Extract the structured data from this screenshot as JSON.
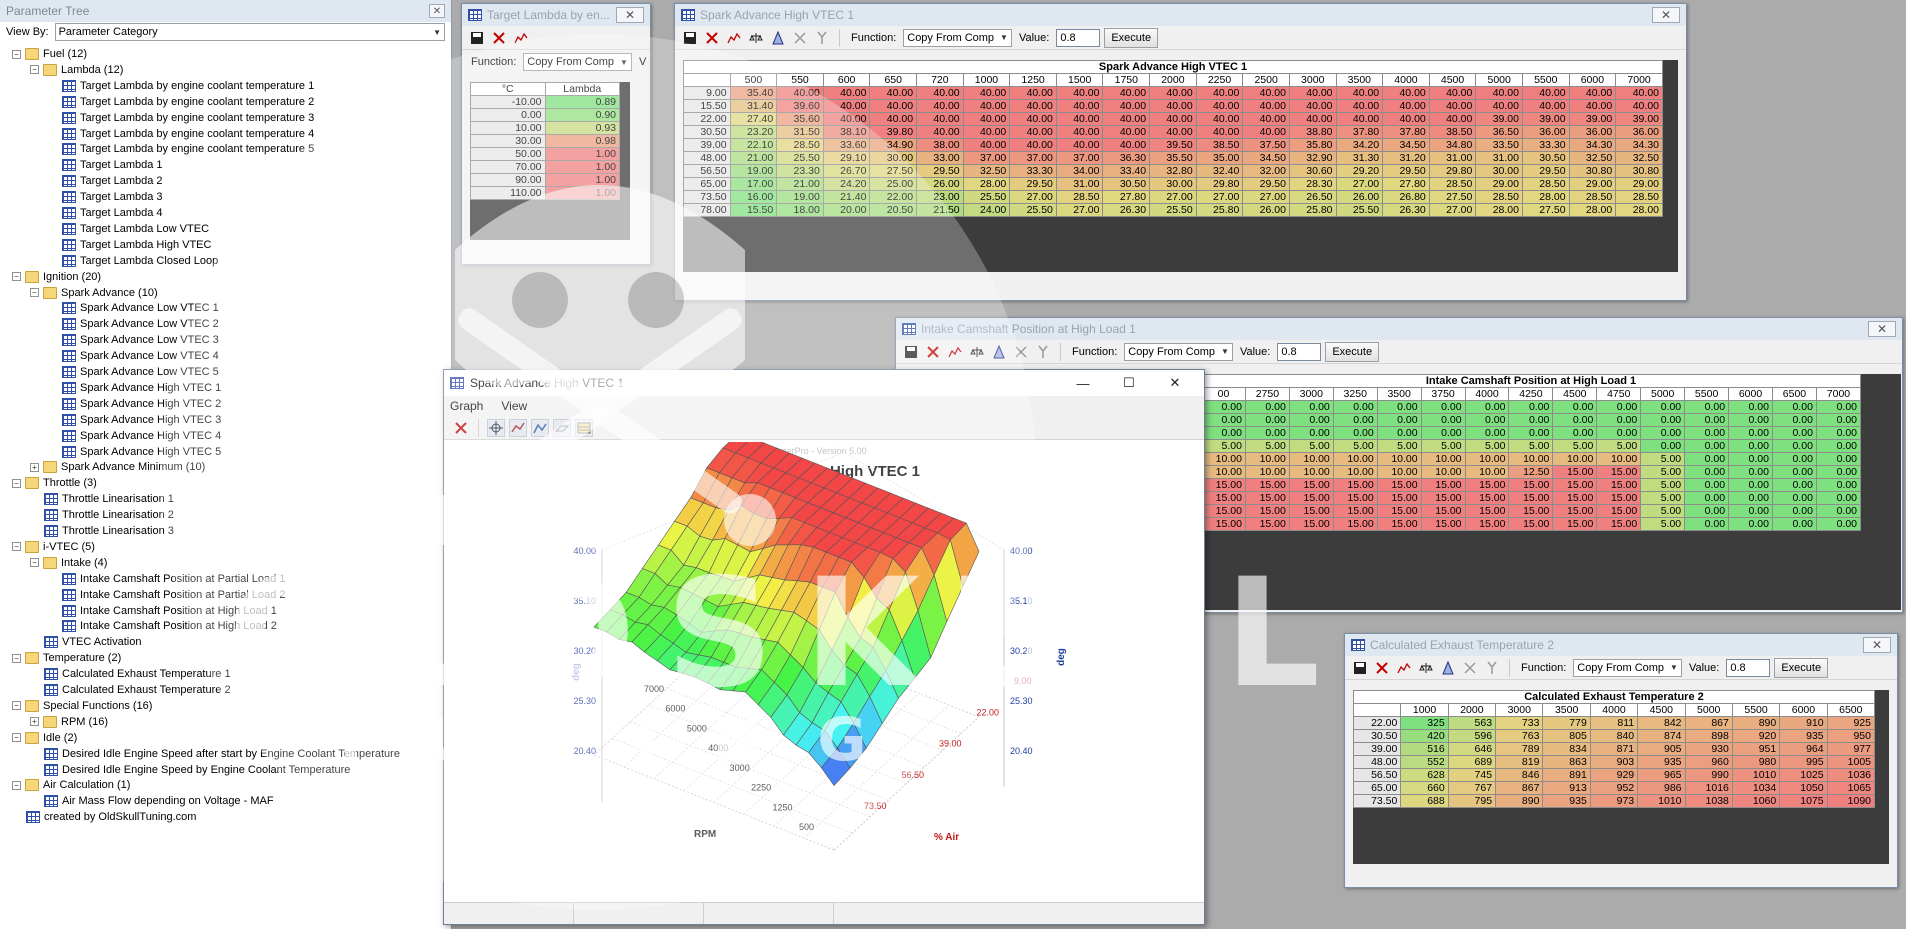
{
  "tree": {
    "title": "Parameter Tree",
    "view_by_label": "View By:",
    "view_by_value": "Parameter Category",
    "close_icon": "close-icon",
    "nodes": [
      {
        "label": "Fuel (12)",
        "depth": 0,
        "kind": "folder",
        "exp": "−"
      },
      {
        "label": "Lambda (12)",
        "depth": 1,
        "kind": "folder",
        "exp": "−"
      },
      {
        "label": "Target Lambda by engine coolant temperature 1",
        "depth": 2,
        "kind": "table"
      },
      {
        "label": "Target Lambda by engine coolant temperature 2",
        "depth": 2,
        "kind": "table"
      },
      {
        "label": "Target Lambda by engine coolant temperature 3",
        "depth": 2,
        "kind": "table"
      },
      {
        "label": "Target Lambda by engine coolant temperature 4",
        "depth": 2,
        "kind": "table"
      },
      {
        "label": "Target Lambda by engine coolant temperature 5",
        "depth": 2,
        "kind": "table"
      },
      {
        "label": "Target Lambda 1",
        "depth": 2,
        "kind": "table"
      },
      {
        "label": "Target Lambda 2",
        "depth": 2,
        "kind": "table"
      },
      {
        "label": "Target Lambda 3",
        "depth": 2,
        "kind": "table"
      },
      {
        "label": "Target Lambda 4",
        "depth": 2,
        "kind": "table"
      },
      {
        "label": "Target Lambda Low VTEC",
        "depth": 2,
        "kind": "table"
      },
      {
        "label": "Target Lambda High VTEC",
        "depth": 2,
        "kind": "table"
      },
      {
        "label": "Target Lambda Closed Loop",
        "depth": 2,
        "kind": "table"
      },
      {
        "label": "Ignition (20)",
        "depth": 0,
        "kind": "folder",
        "exp": "−"
      },
      {
        "label": "Spark Advance (10)",
        "depth": 1,
        "kind": "folder",
        "exp": "−"
      },
      {
        "label": "Spark Advance Low VTEC 1",
        "depth": 2,
        "kind": "table"
      },
      {
        "label": "Spark Advance Low VTEC 2",
        "depth": 2,
        "kind": "table"
      },
      {
        "label": "Spark Advance Low VTEC 3",
        "depth": 2,
        "kind": "table"
      },
      {
        "label": "Spark Advance Low VTEC 4",
        "depth": 2,
        "kind": "table"
      },
      {
        "label": "Spark Advance Low VTEC 5",
        "depth": 2,
        "kind": "table"
      },
      {
        "label": "Spark Advance High VTEC 1",
        "depth": 2,
        "kind": "table"
      },
      {
        "label": "Spark Advance High VTEC 2",
        "depth": 2,
        "kind": "table"
      },
      {
        "label": "Spark Advance High VTEC 3",
        "depth": 2,
        "kind": "table"
      },
      {
        "label": "Spark Advance High VTEC 4",
        "depth": 2,
        "kind": "table"
      },
      {
        "label": "Spark Advance High VTEC 5",
        "depth": 2,
        "kind": "table"
      },
      {
        "label": "Spark Advance Minimum (10)",
        "depth": 1,
        "kind": "folder",
        "exp": "+"
      },
      {
        "label": "Throttle (3)",
        "depth": 0,
        "kind": "folder",
        "exp": "−"
      },
      {
        "label": "Throttle Linearisation 1",
        "depth": 1,
        "kind": "table"
      },
      {
        "label": "Throttle Linearisation 2",
        "depth": 1,
        "kind": "table"
      },
      {
        "label": "Throttle Linearisation 3",
        "depth": 1,
        "kind": "table"
      },
      {
        "label": "i-VTEC (5)",
        "depth": 0,
        "kind": "folder",
        "exp": "−"
      },
      {
        "label": "Intake (4)",
        "depth": 1,
        "kind": "folder",
        "exp": "−"
      },
      {
        "label": "Intake Camshaft Position at Partial Load 1",
        "depth": 2,
        "kind": "table"
      },
      {
        "label": "Intake Camshaft Position at Partial Load 2",
        "depth": 2,
        "kind": "table"
      },
      {
        "label": "Intake Camshaft Position at High Load 1",
        "depth": 2,
        "kind": "table"
      },
      {
        "label": "Intake Camshaft Position at High Load 2",
        "depth": 2,
        "kind": "table"
      },
      {
        "label": "VTEC Activation",
        "depth": 1,
        "kind": "table"
      },
      {
        "label": "Temperature (2)",
        "depth": 0,
        "kind": "folder",
        "exp": "−"
      },
      {
        "label": "Calculated Exhaust Temperature 1",
        "depth": 1,
        "kind": "table"
      },
      {
        "label": "Calculated Exhaust Temperature 2",
        "depth": 1,
        "kind": "table"
      },
      {
        "label": "Special Functions (16)",
        "depth": 0,
        "kind": "folder",
        "exp": "−"
      },
      {
        "label": "RPM (16)",
        "depth": 1,
        "kind": "folder",
        "exp": "+"
      },
      {
        "label": "Idle (2)",
        "depth": 0,
        "kind": "folder",
        "exp": "−"
      },
      {
        "label": "Desired Idle Engine Speed after start by Engine Coolant Temperature",
        "depth": 1,
        "kind": "table"
      },
      {
        "label": "Desired Idle Engine Speed by Engine Coolant Temperature",
        "depth": 1,
        "kind": "table"
      },
      {
        "label": "Air Calculation (1)",
        "depth": 0,
        "kind": "folder",
        "exp": "−"
      },
      {
        "label": "Air Mass Flow depending on Voltage - MAF",
        "depth": 1,
        "kind": "table"
      },
      {
        "label": "created by OldSkullTuning.com",
        "depth": 0,
        "kind": "table"
      }
    ]
  },
  "toolbar_common": {
    "function_label": "Function:",
    "function_value": "Copy From Comp",
    "value_label": "Value:",
    "value_value": "0.8",
    "execute_label": "Execute"
  },
  "lambda_win": {
    "title": "Target Lambda by en...",
    "function_label": "Function:",
    "function_value": "Copy From Comp",
    "extra_label": "V",
    "col_headers": [
      "°C",
      "Lambda"
    ],
    "rows": [
      [
        "-10.00",
        "0.89"
      ],
      [
        "0.00",
        "0.90"
      ],
      [
        "10.00",
        "0.93"
      ],
      [
        "30.00",
        "0.98"
      ],
      [
        "50.00",
        "1.00"
      ],
      [
        "70.00",
        "1.00"
      ],
      [
        "90.00",
        "1.00"
      ],
      [
        "110.00",
        "1.00"
      ]
    ]
  },
  "spark_win": {
    "title": "Spark Advance High VTEC 1",
    "table_title": "Spark Advance High VTEC 1",
    "cols": [
      "500",
      "550",
      "600",
      "650",
      "720",
      "1000",
      "1250",
      "1500",
      "1750",
      "2000",
      "2250",
      "2500",
      "3000",
      "3500",
      "4000",
      "4500",
      "5000",
      "5500",
      "6000",
      "7000"
    ],
    "row_headers": [
      "9.00",
      "15.50",
      "22.00",
      "30.50",
      "39.00",
      "48.00",
      "56.50",
      "65.00",
      "73.50",
      "78.00"
    ],
    "rows": [
      [
        "35.40",
        "40.00",
        "40.00",
        "40.00",
        "40.00",
        "40.00",
        "40.00",
        "40.00",
        "40.00",
        "40.00",
        "40.00",
        "40.00",
        "40.00",
        "40.00",
        "40.00",
        "40.00",
        "40.00",
        "40.00",
        "40.00",
        "40.00"
      ],
      [
        "31.40",
        "39.60",
        "40.00",
        "40.00",
        "40.00",
        "40.00",
        "40.00",
        "40.00",
        "40.00",
        "40.00",
        "40.00",
        "40.00",
        "40.00",
        "40.00",
        "40.00",
        "40.00",
        "40.00",
        "40.00",
        "40.00",
        "40.00"
      ],
      [
        "27.40",
        "35.60",
        "40.00",
        "40.00",
        "40.00",
        "40.00",
        "40.00",
        "40.00",
        "40.00",
        "40.00",
        "40.00",
        "40.00",
        "40.00",
        "40.00",
        "40.00",
        "40.00",
        "39.00",
        "39.00",
        "39.00",
        "39.00"
      ],
      [
        "23.20",
        "31.50",
        "38.10",
        "39.80",
        "40.00",
        "40.00",
        "40.00",
        "40.00",
        "40.00",
        "40.00",
        "40.00",
        "40.00",
        "38.80",
        "37.80",
        "37.80",
        "38.50",
        "36.50",
        "36.00",
        "36.00",
        "36.00"
      ],
      [
        "22.10",
        "28.50",
        "33.60",
        "34.90",
        "38.00",
        "40.00",
        "40.00",
        "40.00",
        "40.00",
        "39.50",
        "38.50",
        "37.50",
        "35.80",
        "34.20",
        "34.50",
        "34.80",
        "33.50",
        "33.30",
        "34.30",
        "34.30"
      ],
      [
        "21.00",
        "25.50",
        "29.10",
        "30.00",
        "33.00",
        "37.00",
        "37.00",
        "37.00",
        "36.30",
        "35.50",
        "35.00",
        "34.50",
        "32.90",
        "31.30",
        "31.20",
        "31.00",
        "31.00",
        "30.50",
        "32.50",
        "32.50"
      ],
      [
        "19.00",
        "23.30",
        "26.70",
        "27.50",
        "29.50",
        "32.50",
        "33.30",
        "34.00",
        "33.40",
        "32.80",
        "32.40",
        "32.00",
        "30.60",
        "29.20",
        "29.50",
        "29.80",
        "30.00",
        "29.50",
        "30.80",
        "30.80"
      ],
      [
        "17.00",
        "21.00",
        "24.20",
        "25.00",
        "26.00",
        "28.00",
        "29.50",
        "31.00",
        "30.50",
        "30.00",
        "29.80",
        "29.50",
        "28.30",
        "27.00",
        "27.80",
        "28.50",
        "29.00",
        "28.50",
        "29.00",
        "29.00"
      ],
      [
        "16.00",
        "19.00",
        "21.40",
        "22.00",
        "23.00",
        "25.50",
        "27.00",
        "28.50",
        "27.80",
        "27.00",
        "27.00",
        "27.00",
        "26.50",
        "26.00",
        "26.80",
        "27.50",
        "28.50",
        "28.00",
        "28.50",
        "28.50"
      ],
      [
        "15.50",
        "18.00",
        "20.00",
        "20.50",
        "21.50",
        "24.00",
        "25.50",
        "27.00",
        "26.30",
        "25.50",
        "25.80",
        "26.00",
        "25.80",
        "25.50",
        "26.30",
        "27.00",
        "28.00",
        "27.50",
        "28.00",
        "28.00"
      ]
    ]
  },
  "cam_win": {
    "title": "Intake Camshaft Position at High Load 1",
    "table_title": "Intake Camshaft Position at High Load 1",
    "cols": [
      "00",
      "2750",
      "3000",
      "3250",
      "3500",
      "3750",
      "4000",
      "4250",
      "4500",
      "4750",
      "5000",
      "5500",
      "6000",
      "6500",
      "7000"
    ],
    "rows": [
      [
        "0.00",
        "0.00",
        "0.00",
        "0.00",
        "0.00",
        "0.00",
        "0.00",
        "0.00",
        "0.00",
        "0.00",
        "0.00",
        "0.00",
        "0.00",
        "0.00",
        "0.00"
      ],
      [
        "0.00",
        "0.00",
        "0.00",
        "0.00",
        "0.00",
        "0.00",
        "0.00",
        "0.00",
        "0.00",
        "0.00",
        "0.00",
        "0.00",
        "0.00",
        "0.00",
        "0.00"
      ],
      [
        "0.00",
        "0.00",
        "0.00",
        "0.00",
        "0.00",
        "0.00",
        "0.00",
        "0.00",
        "0.00",
        "0.00",
        "0.00",
        "0.00",
        "0.00",
        "0.00",
        "0.00"
      ],
      [
        "5.00",
        "5.00",
        "5.00",
        "5.00",
        "5.00",
        "5.00",
        "5.00",
        "5.00",
        "5.00",
        "5.00",
        "0.00",
        "0.00",
        "0.00",
        "0.00",
        "0.00"
      ],
      [
        "10.00",
        "10.00",
        "10.00",
        "10.00",
        "10.00",
        "10.00",
        "10.00",
        "10.00",
        "10.00",
        "10.00",
        "5.00",
        "0.00",
        "0.00",
        "0.00",
        "0.00"
      ],
      [
        "10.00",
        "10.00",
        "10.00",
        "10.00",
        "10.00",
        "10.00",
        "10.00",
        "12.50",
        "15.00",
        "15.00",
        "5.00",
        "0.00",
        "0.00",
        "0.00",
        "0.00"
      ],
      [
        "15.00",
        "15.00",
        "15.00",
        "15.00",
        "15.00",
        "15.00",
        "15.00",
        "15.00",
        "15.00",
        "15.00",
        "5.00",
        "0.00",
        "0.00",
        "0.00",
        "0.00"
      ],
      [
        "15.00",
        "15.00",
        "15.00",
        "15.00",
        "15.00",
        "15.00",
        "15.00",
        "15.00",
        "15.00",
        "15.00",
        "5.00",
        "0.00",
        "0.00",
        "0.00",
        "0.00"
      ],
      [
        "15.00",
        "15.00",
        "15.00",
        "15.00",
        "15.00",
        "15.00",
        "15.00",
        "15.00",
        "15.00",
        "15.00",
        "5.00",
        "0.00",
        "0.00",
        "0.00",
        "0.00"
      ],
      [
        "15.00",
        "15.00",
        "15.00",
        "15.00",
        "15.00",
        "15.00",
        "15.00",
        "15.00",
        "15.00",
        "15.00",
        "5.00",
        "0.00",
        "0.00",
        "0.00",
        "0.00"
      ]
    ]
  },
  "exh_win": {
    "title": "Calculated Exhaust Temperature 2",
    "table_title": "Calculated Exhaust Temperature 2",
    "cols": [
      "1000",
      "2000",
      "3000",
      "3500",
      "4000",
      "4500",
      "5000",
      "5500",
      "6000",
      "6500"
    ],
    "row_headers": [
      "22.00",
      "30.50",
      "39.00",
      "48.00",
      "56.50",
      "65.00",
      "73.50"
    ],
    "rows": [
      [
        "325",
        "563",
        "733",
        "779",
        "811",
        "842",
        "867",
        "890",
        "910",
        "925"
      ],
      [
        "420",
        "596",
        "763",
        "805",
        "840",
        "874",
        "898",
        "920",
        "935",
        "950"
      ],
      [
        "516",
        "646",
        "789",
        "834",
        "871",
        "905",
        "930",
        "951",
        "964",
        "977"
      ],
      [
        "552",
        "689",
        "819",
        "863",
        "903",
        "935",
        "960",
        "980",
        "995",
        "1005"
      ],
      [
        "628",
        "745",
        "846",
        "891",
        "929",
        "965",
        "990",
        "1010",
        "1025",
        "1036"
      ],
      [
        "660",
        "767",
        "867",
        "913",
        "952",
        "986",
        "1016",
        "1034",
        "1050",
        "1065"
      ],
      [
        "688",
        "795",
        "890",
        "935",
        "973",
        "1010",
        "1038",
        "1060",
        "1075",
        "1090"
      ]
    ]
  },
  "graph_win": {
    "title": "Spark Advance High VTEC 1",
    "menu": [
      "Graph",
      "View"
    ],
    "version_text": "TunerPro - Version 5.00",
    "chart_title": "Spark Advance High VTEC 1",
    "z_label": "deg",
    "x_label": "% Air",
    "y_label": "RPM",
    "z_ticks": [
      "40.00",
      "35.10",
      "30.20",
      "25.30",
      "20.40"
    ],
    "z_ticks_right": [
      "40.00",
      "35.10",
      "30.20",
      "25.30",
      "20.40"
    ],
    "air_ticks": [
      "9.00",
      "22.00",
      "39.00",
      "56.50",
      "73.50"
    ],
    "rpm_ticks": [
      "7000",
      "6000",
      "5000",
      "4000",
      "3000",
      "2250",
      "1250",
      "500"
    ]
  },
  "colors": {
    "heat_green": "#7fe07f",
    "heat_yellow": "#e2d880",
    "heat_red": "#f08080"
  }
}
